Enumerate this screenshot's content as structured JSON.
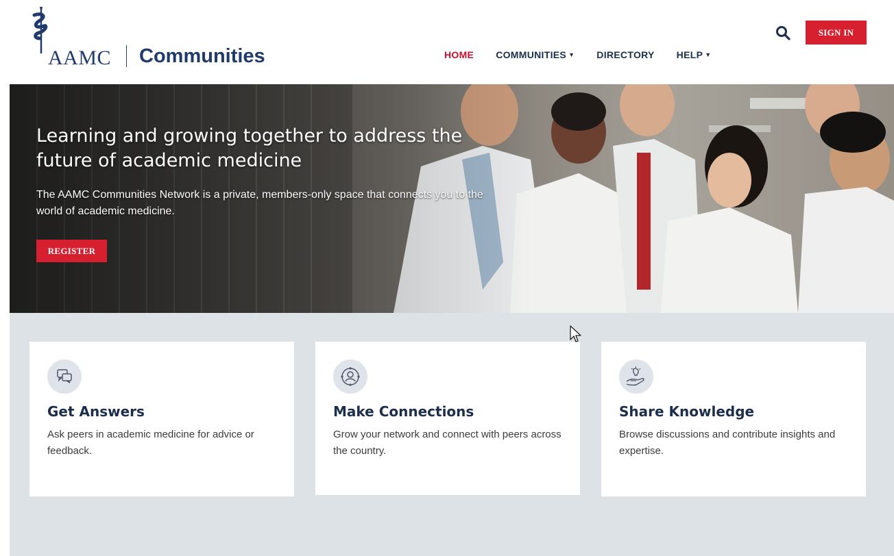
{
  "header": {
    "logo_aamc": "AAMC",
    "logo_communities": "Communities",
    "nav": [
      {
        "label": "HOME",
        "active": true,
        "caret": false
      },
      {
        "label": "COMMUNITIES",
        "active": false,
        "caret": true
      },
      {
        "label": "DIRECTORY",
        "active": false,
        "caret": false
      },
      {
        "label": "HELP",
        "active": false,
        "caret": true
      }
    ],
    "search_icon": "search-icon",
    "signin_label": "SIGN IN"
  },
  "hero": {
    "title": "Learning and growing together to address the future of academic medicine",
    "subtitle": "The AAMC Communities  Network is a private, members-only space that connects you to the world of academic medicine.",
    "register_label": "REGISTER"
  },
  "cards": [
    {
      "icon": "chat-bubbles-icon",
      "title": "Get Answers",
      "desc": "Ask peers in academic medicine for advice or feedback."
    },
    {
      "icon": "network-person-icon",
      "title": "Make Connections",
      "desc": "Grow your network and connect with peers across the country."
    },
    {
      "icon": "lightbulb-hand-icon",
      "title": "Share Knowledge",
      "desc": "Browse discussions and contribute insights and expertise."
    }
  ],
  "colors": {
    "brand_navy": "#1f3a6b",
    "accent_red": "#d61f2f",
    "active_nav": "#c8102e",
    "content_bg": "#dde2e7"
  }
}
